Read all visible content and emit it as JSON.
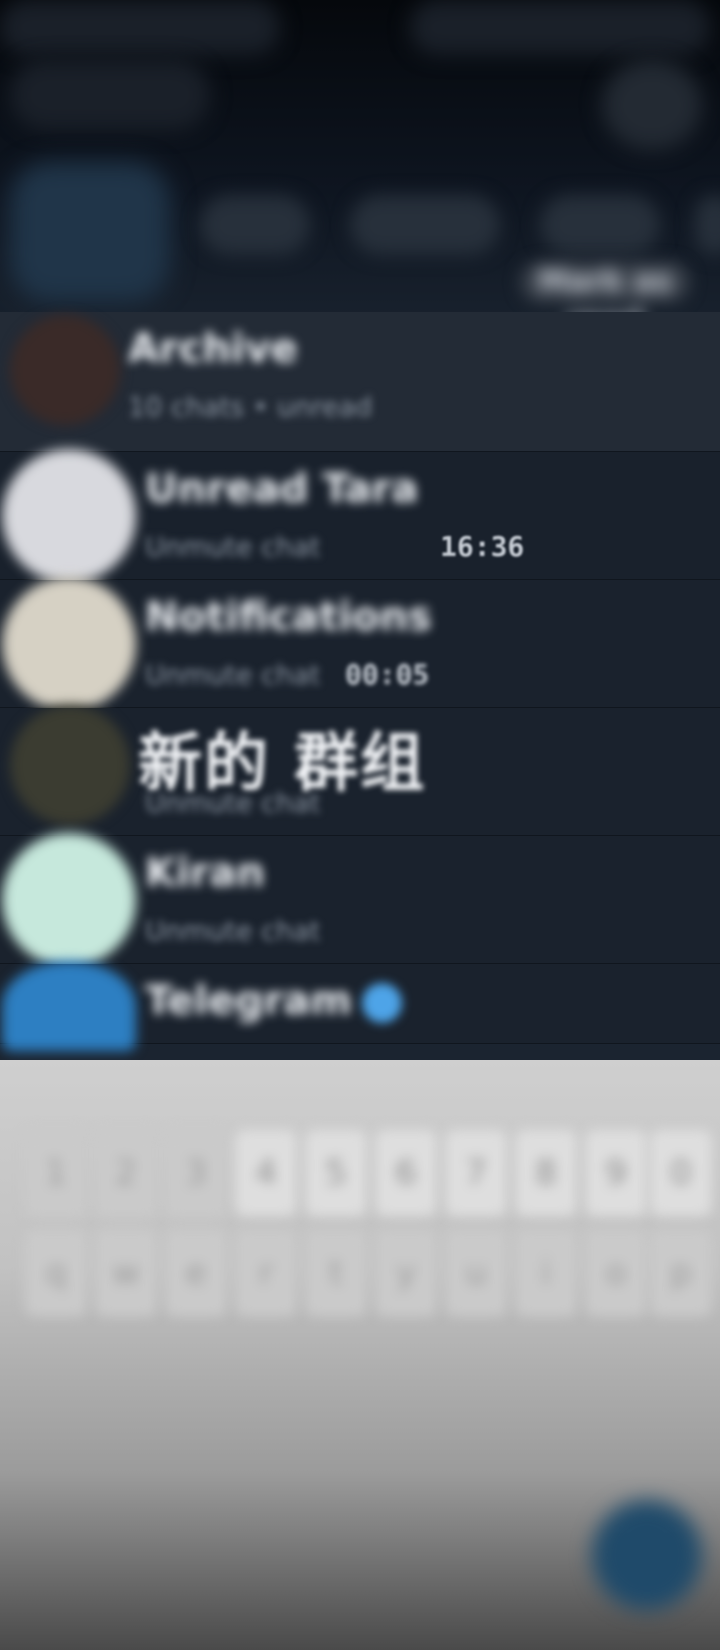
{
  "header": {
    "mark_read_label": "Mark as read"
  },
  "chats": [
    {
      "name": "Archive",
      "subtitle": "10 chats • unread",
      "time": ""
    },
    {
      "name": "Unread Tara",
      "subtitle": "Unmute chat",
      "time": "16:36"
    },
    {
      "name": "Notifications",
      "subtitle": "Unmute chat",
      "time": "00:05"
    },
    {
      "name": "新的 群组",
      "subtitle": "Unmute chat",
      "time": ""
    },
    {
      "name": "Kiran",
      "subtitle": "Unmute chat",
      "time": ""
    },
    {
      "name": "Telegram",
      "subtitle": "",
      "time": "",
      "verified": true
    }
  ],
  "keyboard": {
    "row1": [
      "1",
      "2",
      "3",
      "4",
      "5",
      "6",
      "7",
      "8",
      "9",
      "0"
    ],
    "row2": [
      "q",
      "w",
      "e",
      "r",
      "t",
      "y",
      "u",
      "i",
      "o",
      "p"
    ]
  },
  "colors": {
    "background": "#1a222d",
    "highlight_row": "#232b36",
    "accent": "#4ea4e8",
    "keyboard": "#cfcfcf"
  },
  "icons": {
    "fab": "pencil-icon",
    "verified": "verified-badge-icon"
  }
}
